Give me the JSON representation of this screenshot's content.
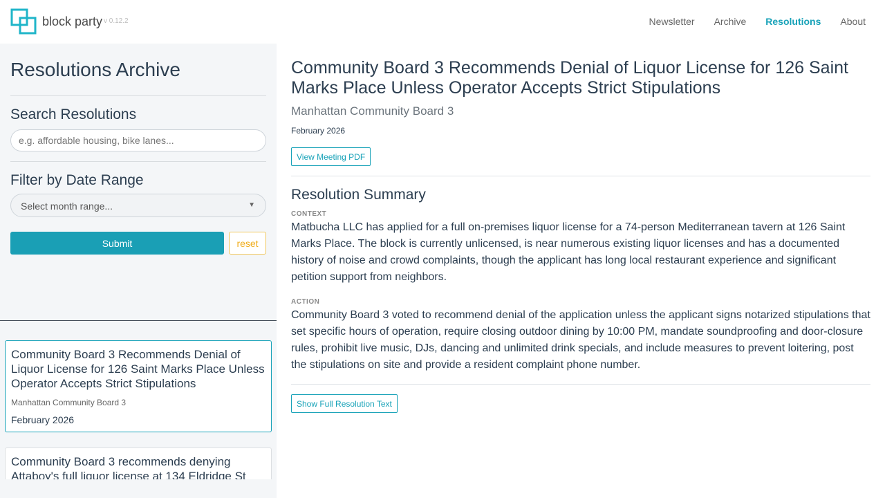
{
  "header": {
    "brand": "block party",
    "version": "v 0.12.2",
    "nav": [
      {
        "label": "Newsletter",
        "active": false
      },
      {
        "label": "Archive",
        "active": false
      },
      {
        "label": "Resolutions",
        "active": true
      },
      {
        "label": "About",
        "active": false
      }
    ]
  },
  "sidebar": {
    "title": "Resolutions Archive",
    "search_heading": "Search Resolutions",
    "search_placeholder": "e.g. affordable housing, bike lanes...",
    "date_heading": "Filter by Date Range",
    "date_select_label": "Select month range...",
    "submit_label": "Submit",
    "reset_label": "reset",
    "results": [
      {
        "title": "Community Board 3 Recommends Denial of Liquor License for 126 Saint Marks Place Unless Operator Accepts Strict Stipulations",
        "org": "Manhattan Community Board 3",
        "date": "February 2026"
      },
      {
        "title": "Community Board 3 recommends denying Attaboy's full liquor license at 134 Eldridge St",
        "org": "",
        "date": ""
      }
    ]
  },
  "main": {
    "title": "Community Board 3 Recommends Denial of Liquor License for 126 Saint Marks Place Unless Operator Accepts Strict Stipulations",
    "org": "Manhattan Community Board 3",
    "date": "February 2026",
    "pdf_button": "View Meeting PDF",
    "summary_heading": "Resolution Summary",
    "context_label": "CONTEXT",
    "context_text": "Matbucha LLC has applied for a full on-premises liquor license for a 74-person Mediterranean tavern at 126 Saint Marks Place. The block is currently unlicensed, is near numerous existing liquor licenses and has a documented history of noise and crowd complaints, though the applicant has long local restaurant experience and significant petition support from neighbors.",
    "action_label": "ACTION",
    "action_text": "Community Board 3 voted to recommend denial of the application unless the applicant signs notarized stipulations that set specific hours of operation, require closing outdoor dining by 10:00 PM, mandate soundproofing and door-closure rules, prohibit live music, DJs, dancing and unlimited drink specials, and include measures to prevent loitering, post the stipulations on site and provide a resident complaint phone number.",
    "full_text_button": "Show Full Resolution Text"
  },
  "colors": {
    "accent": "#17a2b8",
    "reset": "#f0ad1c",
    "sidebar_bg": "#f4f6f8"
  }
}
